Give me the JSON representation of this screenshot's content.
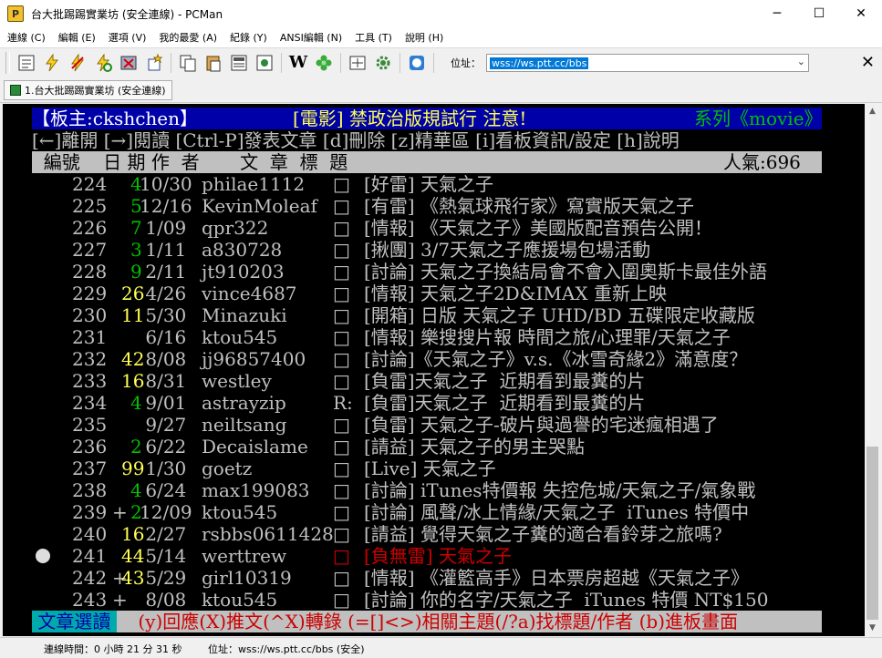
{
  "window": {
    "title": "台大批踢踢實業坊 (安全連線) - PCMan",
    "minimize": "─",
    "maximize": "☐",
    "close": "✕"
  },
  "menu": [
    "連線 (C)",
    "編輯 (E)",
    "選項 (V)",
    "我的最愛 (A)",
    "紀錄 (Y)",
    "ANSI編輯 (N)",
    "工具 (T)",
    "說明 (H)"
  ],
  "toolbar": {
    "icons": [
      "address-book-icon",
      "connect-icon",
      "disconnect-icon",
      "reconnect-icon",
      "close-connection-icon",
      "add-favorite-icon",
      "copy-icon",
      "paste-icon",
      "paste-special-icon",
      "screenshot-icon",
      "wikipedia-icon",
      "flower-icon",
      "fullscreen-icon",
      "settings-icon",
      "pcman-icon"
    ],
    "address_label": "位址：",
    "address_value": "wss://ws.ptt.cc/bbs",
    "close_glyph": "✕"
  },
  "tab": {
    "label": "1.台大批踢踢實業坊 (安全連線)"
  },
  "terminal": {
    "header": {
      "moderator": "【板主:ckshchen】",
      "notice": "[電影] 禁政治版規試行 注意!",
      "series": "系列《movie》"
    },
    "help_line": "[←]離開 [→]閱讀 [Ctrl-P]發表文章 [d]刪除 [z]精華區 [i]看板資訊/設定 [h]說明",
    "columns": {
      "left": "  編號    日 期 作  者       文  章  標  題",
      "popularity": "人氣:696"
    },
    "rows": [
      {
        "num": "224",
        "recs": "4",
        "date": "10/30",
        "author": "philae1112",
        "mark": "□",
        "title": "[好雷] 天氣之子"
      },
      {
        "num": "225",
        "recs": "5",
        "date": "12/16",
        "author": "KevinMoleaf",
        "mark": "□",
        "title": "[有雷] 《熱氣球飛行家》寫實版天氣之子"
      },
      {
        "num": "226",
        "recs": "7",
        "date": " 1/09",
        "author": "qpr322",
        "mark": "□",
        "title": "[情報] 《天氣之子》美國版配音預告公開！"
      },
      {
        "num": "227",
        "recs": "3",
        "date": " 1/11",
        "author": "a830728",
        "mark": "□",
        "title": "[揪團] 3/7天氣之子應援場包場活動"
      },
      {
        "num": "228",
        "recs": "9",
        "date": " 2/11",
        "author": "jt910203",
        "mark": "□",
        "title": "[討論] 天氣之子換結局會不會入圍奧斯卡最佳外語"
      },
      {
        "num": "229",
        "recs": "26",
        "date": " 4/26",
        "author": "vince4687",
        "mark": "□",
        "title": "[情報] 天氣之子2D&IMAX 重新上映"
      },
      {
        "num": "230",
        "recs": "11",
        "date": " 5/30",
        "author": "Minazuki",
        "mark": "□",
        "title": "[開箱] 日版 天氣之子 UHD/BD 五碟限定收藏版"
      },
      {
        "num": "231",
        "recs": "",
        "date": " 6/16",
        "author": "ktou545",
        "mark": "□",
        "title": "[情報] 樂搜搜片報 時間之旅/心理罪/天氣之子"
      },
      {
        "num": "232",
        "recs": "42",
        "date": " 8/08",
        "author": "jj96857400",
        "mark": "□",
        "title": "[討論]《天氣之子》v.s.《冰雪奇緣2》滿意度？"
      },
      {
        "num": "233",
        "recs": "16",
        "date": " 8/31",
        "author": "westley",
        "mark": "□",
        "title": "[負雷]天氣之子  近期看到最糞的片"
      },
      {
        "num": "234",
        "recs": "4",
        "date": " 9/01",
        "author": "astrayzip",
        "mark": "R:",
        "title": "[負雷]天氣之子  近期看到最糞的片"
      },
      {
        "num": "235",
        "recs": "",
        "date": " 9/27",
        "author": "neiltsang",
        "mark": "□",
        "title": "[負雷] 天氣之子-破片與過譽的宅迷瘋相遇了"
      },
      {
        "num": "236",
        "recs": "2",
        "date": " 6/22",
        "author": "Decaislame",
        "mark": "□",
        "title": "[請益] 天氣之子的男主哭點"
      },
      {
        "num": "237",
        "recs": "99",
        "date": " 1/30",
        "author": "goetz",
        "mark": "□",
        "title": "[Live] 天氣之子"
      },
      {
        "num": "238",
        "recs": "4",
        "date": " 6/24",
        "author": "max199083",
        "mark": "□",
        "title": "[討論] iTunes特價報 失控危城/天氣之子/氣象戰"
      },
      {
        "num": "239",
        "recs": "2",
        "date": "12/09",
        "author": "ktou545",
        "mark": "□",
        "title": "[討論] 風聲/冰上情緣/天氣之子  iTunes 特價中"
      },
      {
        "num": "240",
        "recs": "16",
        "date": " 2/27",
        "author": "rsbbs0611428",
        "mark": "□",
        "title": "[請益] 覺得天氣之子糞的適合看鈴芽之旅嗎?"
      },
      {
        "num": "241",
        "recs": "44",
        "date": " 5/14",
        "author": "werttrew",
        "mark": "□",
        "title": "[負無雷] 天氣之子"
      },
      {
        "num": "242",
        "recs": "43",
        "date": " 5/29",
        "author": "girl10319",
        "mark": "□",
        "title": "[情報] 《灌籃高手》日本票房超越《天氣之子》"
      },
      {
        "num": "243",
        "recs": "",
        "date": " 8/08",
        "author": "ktou545",
        "mark": "□",
        "title": "[討論] 你的名字/天氣之子  iTunes 特價 NT$150"
      }
    ],
    "row_239_plus": "+",
    "row_242_plus": "+",
    "row_243_plus": "+",
    "footer": {
      "label": " 文章選讀 ",
      "text": " (y)回應(X)推文(^X)轉錄 (=[]<>)相關主題(/?a)找標題/作者 (b)進板畫面 "
    }
  },
  "status": {
    "time": "連線時間：0 小時 21 分 31 秒",
    "address": "位址：wss://ws.ptt.cc/bbs (安全)"
  },
  "colors": {
    "header_bg": "#0000a8",
    "cyan": "#00aaaa",
    "green": "#00c000",
    "yellow": "#ffff55",
    "red": "#cc0000",
    "gray_bar": "#c0c0c0"
  }
}
